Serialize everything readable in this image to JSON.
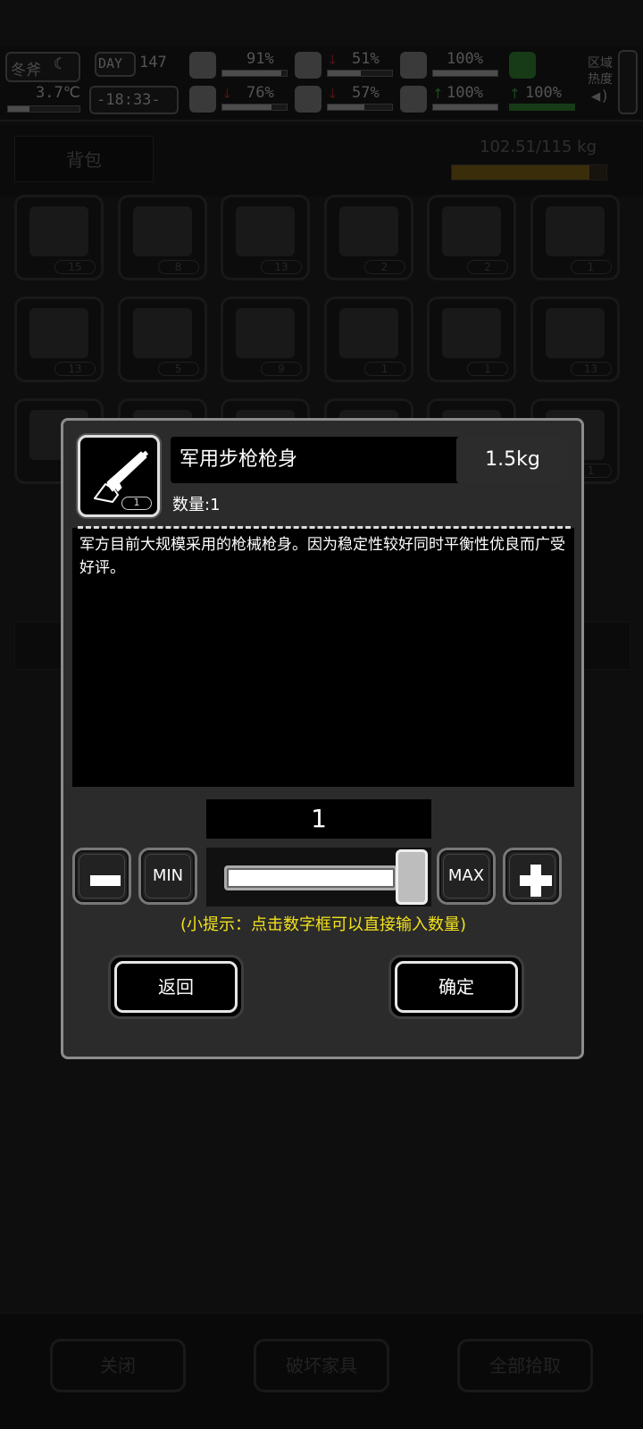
{
  "status": {
    "season": "冬斧",
    "day_label": "DAY",
    "day_value": "147",
    "temperature": "3.7℃",
    "time": "-18:33-",
    "health_pct": "91%",
    "stomach_pct": "51%",
    "bladder_pct": "100%",
    "brain_pct": "76%",
    "water_pct": "57%",
    "heart_pct": "100%",
    "stamina_pct": "100%",
    "area_heat_label": "区域\n热度"
  },
  "inventory": {
    "tab_label": "背包",
    "weight_text": "102.51/115 kg",
    "weight_fraction": 0.89,
    "slots": [
      {
        "count": "15"
      },
      {
        "count": "8"
      },
      {
        "count": "13"
      },
      {
        "count": "2"
      },
      {
        "count": "2"
      },
      {
        "count": "1"
      },
      {
        "count": "13"
      },
      {
        "count": "5"
      },
      {
        "count": "9"
      },
      {
        "count": "1"
      },
      {
        "count": "1"
      },
      {
        "count": "13"
      },
      {
        "count": ""
      },
      {
        "count": ""
      },
      {
        "count": ""
      },
      {
        "count": ""
      },
      {
        "count": ""
      },
      {
        "count": "1"
      }
    ]
  },
  "bottom_bar": {
    "close_label": "关闭",
    "destroy_label": "破坏家具",
    "pickup_all_label": "全部拾取"
  },
  "dialog": {
    "item_icon": "rifle-body-icon",
    "icon_count": "1",
    "item_name": "军用步枪枪身",
    "item_weight": "1.5kg",
    "quantity_text": "数量:1",
    "description": "军方目前大规模采用的枪械枪身。因为稳定性较好同时平衡性优良而广受好评。",
    "selected_quantity": "1",
    "slider_fraction": 1.0,
    "min_label": "MIN",
    "max_label": "MAX",
    "tip": "(小提示：点击数字框可以直接输入数量)",
    "back_label": "返回",
    "confirm_label": "确定"
  }
}
